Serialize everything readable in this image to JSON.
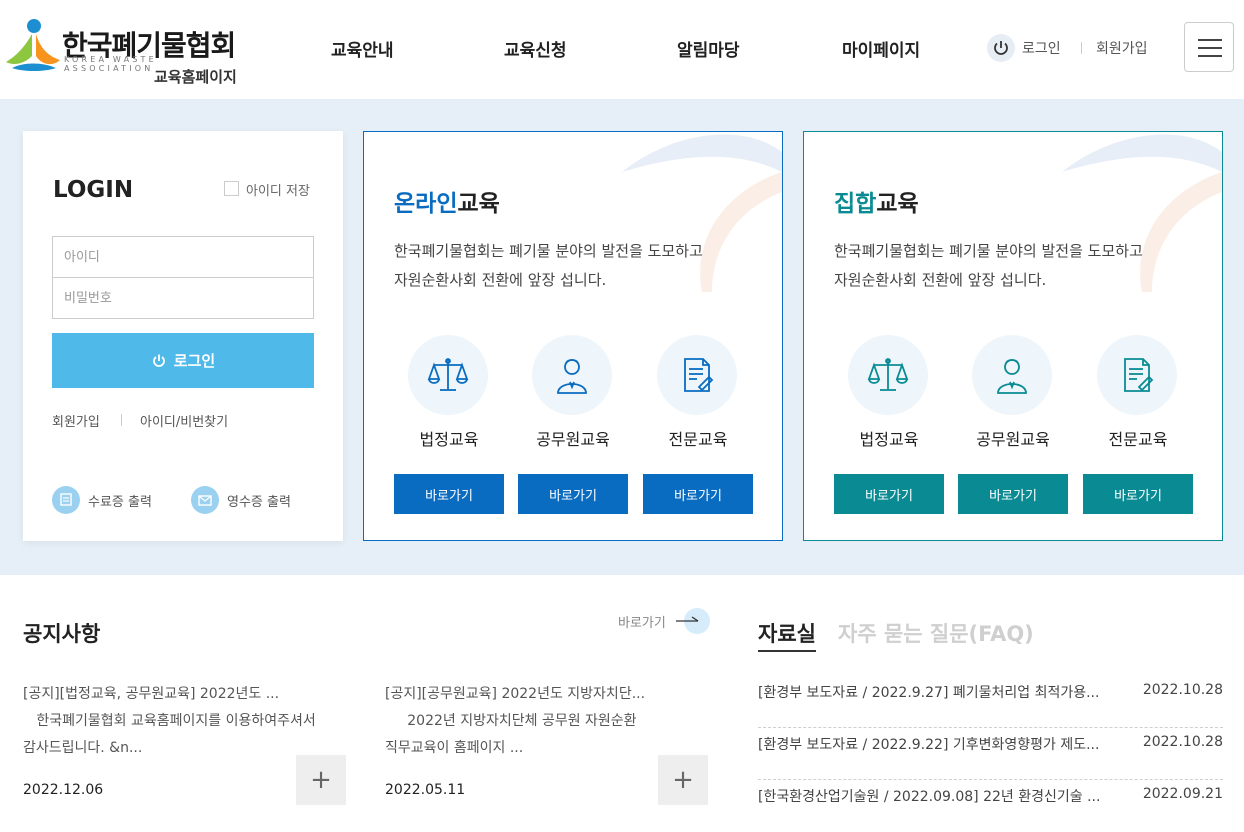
{
  "brand": {
    "title": "한국폐기물협회",
    "eng": "KOREA WASTE ASSOCIATION",
    "sub": "교육홈페이지"
  },
  "nav": [
    "교육안내",
    "교육신청",
    "알림마당",
    "마이페이지"
  ],
  "util": {
    "login": "로그인",
    "join": "회원가입"
  },
  "login": {
    "title": "LOGIN",
    "save_id": "아이디 저장",
    "id_placeholder": "아이디",
    "pw_placeholder": "비밀번호",
    "button": "로그인",
    "join": "회원가입",
    "find": "아이디/비번찾기",
    "cert": "수료증 출력",
    "receipt": "영수증 출력"
  },
  "online": {
    "title_accent": "온라인",
    "title_rest": "교육",
    "desc1": "한국폐기물협회는 폐기물 분야의 발전을 도모하고",
    "desc2": "자원순환사회 전환에 앞장 섭니다.",
    "items": [
      {
        "label": "법정교육",
        "icon": "scale-icon",
        "button": "바로가기"
      },
      {
        "label": "공무원교육",
        "icon": "person-icon",
        "button": "바로가기"
      },
      {
        "label": "전문교육",
        "icon": "document-icon",
        "button": "바로가기"
      }
    ],
    "color": "#0a6cc1"
  },
  "offline": {
    "title_accent": "집합",
    "title_rest": "교육",
    "desc1": "한국폐기물협회는 폐기물 분야의 발전을 도모하고",
    "desc2": "자원순환사회 전환에 앞장 섭니다.",
    "items": [
      {
        "label": "법정교육",
        "icon": "scale-icon",
        "button": "바로가기"
      },
      {
        "label": "공무원교육",
        "icon": "person-icon",
        "button": "바로가기"
      },
      {
        "label": "전문교육",
        "icon": "document-icon",
        "button": "바로가기"
      }
    ],
    "color": "#0a8b94"
  },
  "notice": {
    "title": "공지사항",
    "more": "바로가기",
    "items": [
      {
        "line1": "[공지][법정교육, 공무원교육] 2022년도 ...",
        "line2": "   한국폐기물협회 교육홈페이지를 이용하여주셔서",
        "line3": "감사드립니다. &n...",
        "date": "2022.12.06"
      },
      {
        "line1": "[공지][공무원교육] 2022년도 지방자치단...",
        "line2": "     2022년 지방자치단체 공무원 자원순환",
        "line3": "직무교육이 홈페이지 ...",
        "date": "2022.05.11"
      }
    ]
  },
  "data": {
    "tab_active": "자료실",
    "tab_inactive": "자주 묻는 질문(FAQ)",
    "items": [
      {
        "title": "[환경부 보도자료 / 2022.9.27] 폐기물처리업 최적가용...",
        "date": "2022.10.28"
      },
      {
        "title": "[환경부 보도자료 / 2022.9.22] 기후변화영향평가 제도...",
        "date": "2022.10.28"
      },
      {
        "title": "[한국환경산업기술원 / 2022.09.08] 22년 환경신기술 ...",
        "date": "2022.09.21"
      }
    ]
  }
}
